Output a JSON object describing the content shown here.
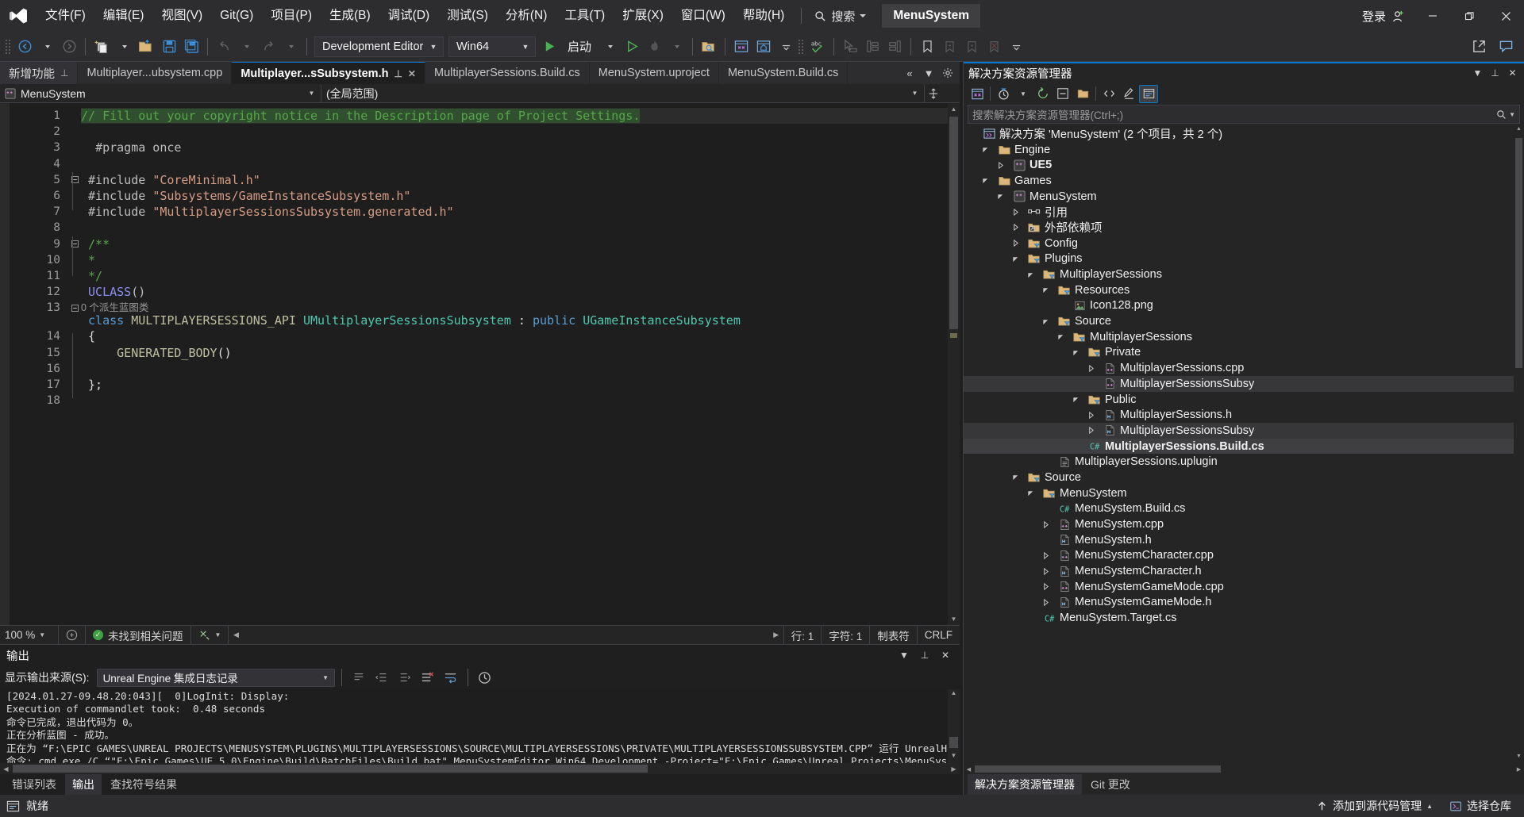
{
  "window": {
    "title": "MenuSystem",
    "signin_label": "登录",
    "minimize": "minimize-icon",
    "restore": "restore-icon",
    "close": "close-icon"
  },
  "menubar": {
    "items": [
      {
        "label": "文件(F)",
        "name": "menu-file"
      },
      {
        "label": "编辑(E)",
        "name": "menu-edit"
      },
      {
        "label": "视图(V)",
        "name": "menu-view"
      },
      {
        "label": "Git(G)",
        "name": "menu-git"
      },
      {
        "label": "项目(P)",
        "name": "menu-project"
      },
      {
        "label": "生成(B)",
        "name": "menu-build"
      },
      {
        "label": "调试(D)",
        "name": "menu-debug"
      },
      {
        "label": "测试(S)",
        "name": "menu-test"
      },
      {
        "label": "分析(N)",
        "name": "menu-analyze"
      },
      {
        "label": "工具(T)",
        "name": "menu-tools"
      },
      {
        "label": "扩展(X)",
        "name": "menu-extensions"
      },
      {
        "label": "窗口(W)",
        "name": "menu-window"
      },
      {
        "label": "帮助(H)",
        "name": "menu-help"
      }
    ],
    "search_label": "搜索"
  },
  "toolbar": {
    "configuration": "Development Editor",
    "platform": "Win64",
    "start_label": "启动"
  },
  "tabs": [
    {
      "label": "新增功能",
      "name": "tab-whats-new",
      "state": "pinned-pane",
      "pin": true,
      "close": false
    },
    {
      "label": "Multiplayer...ubsystem.cpp",
      "name": "tab-multiplayer-subsystem-cpp",
      "state": "inactive",
      "pin": false,
      "close": false
    },
    {
      "label": "Multiplayer...sSubsystem.h",
      "name": "tab-multiplayer-subsystem-h",
      "state": "active",
      "pin": true,
      "close": true
    },
    {
      "label": "MultiplayerSessions.Build.cs",
      "name": "tab-multiplayersessions-build-cs",
      "state": "inactive",
      "pin": false,
      "close": false
    },
    {
      "label": "MenuSystem.uproject",
      "name": "tab-menusystem-uproject",
      "state": "inactive",
      "pin": false,
      "close": false
    },
    {
      "label": "MenuSystem.Build.cs",
      "name": "tab-menusystem-build-cs",
      "state": "inactive",
      "pin": false,
      "close": false
    }
  ],
  "navbar": {
    "project": "MenuSystem",
    "scope": "(全局范围)"
  },
  "code": {
    "lines": [
      {
        "n": "1",
        "html": "<span class=\"sel cmt\">// Fill out your copyright notice in the Description page of Project Settings.</span>",
        "highlight": true
      },
      {
        "n": "2",
        "html": ""
      },
      {
        "n": "3",
        "html": "  <span class=\"pp\">#pragma once</span>"
      },
      {
        "n": "4",
        "html": ""
      },
      {
        "n": "5",
        "html": " <span class=\"pp\">#include</span> <span class=\"str\">\"CoreMinimal.h\"</span>",
        "fold": "-"
      },
      {
        "n": "6",
        "html": " <span class=\"pp\">#include</span> <span class=\"str\">\"Subsystems/GameInstanceSubsystem.h\"</span>"
      },
      {
        "n": "7",
        "html": " <span class=\"pp\">#include</span> <span class=\"str\">\"MultiplayerSessionsSubsystem.generated.h\"</span>"
      },
      {
        "n": "8",
        "html": ""
      },
      {
        "n": "9",
        "html": " <span class=\"cmt\">/**</span>",
        "fold": "-"
      },
      {
        "n": "10",
        "html": " <span class=\"cmt\">*</span>"
      },
      {
        "n": "11",
        "html": " <span class=\"cmt\">*/</span>"
      },
      {
        "n": "12",
        "html": " <span class=\"fn\">UCLASS</span><span class=\"pp\">()</span>"
      },
      {
        "n": "13",
        "html": " <span class=\"kw\">class</span> <span class=\"mac\">MULTIPLAYERSESSIONS_API</span> <span class=\"typ\">UMultiplayerSessionsSubsystem</span> : <span class=\"kw\">public</span> <span class=\"typ\">UGameInstanceSubsystem</span>",
        "fold": "-",
        "codelens": "0 个派生蓝图类"
      },
      {
        "n": "14",
        "html": " {"
      },
      {
        "n": "15",
        "html": "     <span class=\"mac\">GENERATED_BODY</span>()"
      },
      {
        "n": "16",
        "html": ""
      },
      {
        "n": "17",
        "html": " };"
      },
      {
        "n": "18",
        "html": ""
      }
    ]
  },
  "editor_status": {
    "zoom": "100 %",
    "issues": "未找到相关问题",
    "line_label": "行: 1",
    "col_label": "字符: 1",
    "tabs_label": "制表符",
    "eol": "CRLF"
  },
  "output": {
    "title": "输出",
    "source_label": "显示输出来源(S):",
    "source_value": "Unreal Engine 集成日志记录",
    "lines": [
      "[2024.01.27-09.48.20:043][  0]LogInit: Display: ",
      "Execution of commandlet took:  0.48 seconds",
      "命令已完成，退出代码为 0。",
      "正在分析蓝图 - 成功。",
      "正在为 “F:\\EPIC GAMES\\UNREAL PROJECTS\\MENUSYSTEM\\PLUGINS\\MULTIPLAYERSESSIONS\\SOURCE\\MULTIPLAYERSESSIONS\\PRIVATE\\MULTIPLAYERSESSIONSSUBSYSTEM.CPP” 运行 UnrealHeaderTool",
      "命令: cmd.exe /C “\"F:\\Epic Games\\UE_5.0\\Engine\\Build\\BatchFiles\\Build.bat\" MenuSystemEditor Win64 Development -Project=\"F:\\Epic Games\\Unreal Projects\\MenuSystem\\MenuSystem.uproje"
    ]
  },
  "panel_tabs": [
    {
      "label": "错误列表",
      "name": "panel-tab-error-list",
      "active": false
    },
    {
      "label": "输出",
      "name": "panel-tab-output",
      "active": true
    },
    {
      "label": "查找符号结果",
      "name": "panel-tab-find-symbol-results",
      "active": false
    }
  ],
  "solution_explorer": {
    "title": "解决方案资源管理器",
    "search_placeholder": "搜索解决方案资源管理器(Ctrl+;)",
    "tree": [
      {
        "indent": 0,
        "label": "解决方案 'MenuSystem' (2 个项目，共 2 个)",
        "icon": "solution-icon",
        "expander": "",
        "bold": false,
        "state": ""
      },
      {
        "indent": 1,
        "label": "Engine",
        "icon": "folder-icon",
        "expander": "down",
        "bold": false,
        "state": ""
      },
      {
        "indent": 2,
        "label": "UE5",
        "icon": "cpp-project-icon",
        "expander": "right",
        "bold": true,
        "state": ""
      },
      {
        "indent": 1,
        "label": "Games",
        "icon": "folder-icon",
        "expander": "down",
        "bold": false,
        "state": ""
      },
      {
        "indent": 2,
        "label": "MenuSystem",
        "icon": "cpp-project-icon",
        "expander": "down",
        "bold": false,
        "state": ""
      },
      {
        "indent": 3,
        "label": "引用",
        "icon": "references-icon",
        "expander": "right",
        "bold": false,
        "state": ""
      },
      {
        "indent": 3,
        "label": "外部依赖项",
        "icon": "external-deps-icon",
        "expander": "right",
        "bold": false,
        "state": ""
      },
      {
        "indent": 3,
        "label": "Config",
        "icon": "filter-folder-icon",
        "expander": "right",
        "bold": false,
        "state": ""
      },
      {
        "indent": 3,
        "label": "Plugins",
        "icon": "filter-folder-icon",
        "expander": "down",
        "bold": false,
        "state": ""
      },
      {
        "indent": 4,
        "label": "MultiplayerSessions",
        "icon": "filter-folder-icon",
        "expander": "down",
        "bold": false,
        "state": ""
      },
      {
        "indent": 5,
        "label": "Resources",
        "icon": "filter-folder-icon",
        "expander": "down",
        "bold": false,
        "state": ""
      },
      {
        "indent": 6,
        "label": "Icon128.png",
        "icon": "image-file-icon",
        "expander": "",
        "bold": false,
        "state": ""
      },
      {
        "indent": 5,
        "label": "Source",
        "icon": "filter-folder-icon",
        "expander": "down",
        "bold": false,
        "state": ""
      },
      {
        "indent": 6,
        "label": "MultiplayerSessions",
        "icon": "filter-folder-icon",
        "expander": "down",
        "bold": false,
        "state": ""
      },
      {
        "indent": 7,
        "label": "Private",
        "icon": "filter-folder-icon",
        "expander": "down",
        "bold": false,
        "state": ""
      },
      {
        "indent": 8,
        "label": "MultiplayerSessions.cpp",
        "icon": "cpp-file-icon",
        "expander": "right",
        "bold": false,
        "state": ""
      },
      {
        "indent": 8,
        "label": "MultiplayerSessionsSubsy",
        "icon": "cpp-file-icon",
        "expander": "",
        "bold": false,
        "state": "sel2"
      },
      {
        "indent": 7,
        "label": "Public",
        "icon": "filter-folder-icon",
        "expander": "down",
        "bold": false,
        "state": ""
      },
      {
        "indent": 8,
        "label": "MultiplayerSessions.h",
        "icon": "h-file-icon",
        "expander": "right",
        "bold": false,
        "state": ""
      },
      {
        "indent": 8,
        "label": "MultiplayerSessionsSubsy",
        "icon": "h-file-icon",
        "expander": "right",
        "bold": false,
        "state": "sel2"
      },
      {
        "indent": 7,
        "label": "MultiplayerSessions.Build.cs",
        "icon": "cs-file-icon",
        "expander": "",
        "bold": true,
        "state": "sel1"
      },
      {
        "indent": 5,
        "label": "MultiplayerSessions.uplugin",
        "icon": "text-file-icon",
        "expander": "",
        "bold": false,
        "state": ""
      },
      {
        "indent": 3,
        "label": "Source",
        "icon": "filter-folder-icon",
        "expander": "down",
        "bold": false,
        "state": ""
      },
      {
        "indent": 4,
        "label": "MenuSystem",
        "icon": "filter-folder-icon",
        "expander": "down",
        "bold": false,
        "state": ""
      },
      {
        "indent": 5,
        "label": "MenuSystem.Build.cs",
        "icon": "cs-file-icon",
        "expander": "",
        "bold": false,
        "state": ""
      },
      {
        "indent": 5,
        "label": "MenuSystem.cpp",
        "icon": "cpp-file-icon",
        "expander": "right",
        "bold": false,
        "state": ""
      },
      {
        "indent": 5,
        "label": "MenuSystem.h",
        "icon": "h-file-icon",
        "expander": "",
        "bold": false,
        "state": ""
      },
      {
        "indent": 5,
        "label": "MenuSystemCharacter.cpp",
        "icon": "cpp-file-icon",
        "expander": "right",
        "bold": false,
        "state": ""
      },
      {
        "indent": 5,
        "label": "MenuSystemCharacter.h",
        "icon": "h-file-icon",
        "expander": "right",
        "bold": false,
        "state": ""
      },
      {
        "indent": 5,
        "label": "MenuSystemGameMode.cpp",
        "icon": "cpp-file-icon",
        "expander": "right",
        "bold": false,
        "state": ""
      },
      {
        "indent": 5,
        "label": "MenuSystemGameMode.h",
        "icon": "h-file-icon",
        "expander": "right",
        "bold": false,
        "state": ""
      },
      {
        "indent": 4,
        "label": "MenuSystem.Target.cs",
        "icon": "cs-file-icon",
        "expander": "",
        "bold": false,
        "state": ""
      }
    ],
    "bottom_tabs": [
      {
        "label": "解决方案资源管理器",
        "name": "se-tab-solution-explorer",
        "active": true
      },
      {
        "label": "Git 更改",
        "name": "se-tab-git-changes",
        "active": false
      }
    ]
  },
  "statusbar": {
    "ready": "就绪",
    "add_to_source_control": "添加到源代码管理",
    "select_repo": "选择仓库"
  },
  "colors": {
    "accent": "#0078d4",
    "chrome": "#2d2d30",
    "editor_bg": "#1e1e1e",
    "comment_green": "#57a64a",
    "string_orange": "#d69d85",
    "keyword_blue": "#569cd6",
    "type_teal": "#4ec9b0"
  }
}
